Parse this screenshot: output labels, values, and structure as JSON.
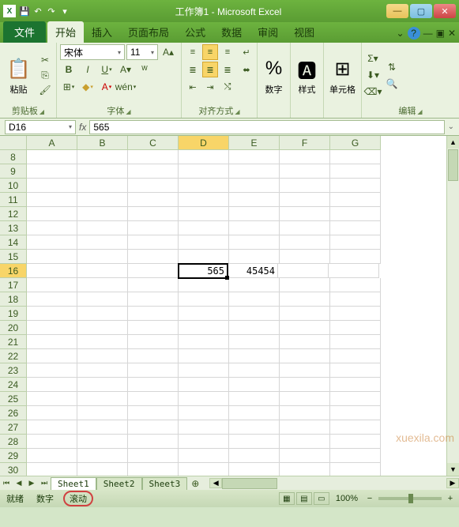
{
  "titlebar": {
    "app_icon": "X",
    "title": "工作簿1 - Microsoft Excel"
  },
  "tabs": {
    "file": "文件",
    "items": [
      "开始",
      "插入",
      "页面布局",
      "公式",
      "数据",
      "审阅",
      "视图"
    ],
    "active_index": 0
  },
  "ribbon": {
    "clipboard": {
      "label": "剪贴板",
      "paste": "粘贴"
    },
    "font": {
      "label": "字体",
      "name": "宋体",
      "size": "11"
    },
    "alignment": {
      "label": "对齐方式"
    },
    "number": {
      "label": "数字",
      "percent": "%"
    },
    "styles": {
      "label": "样式"
    },
    "cells": {
      "label": "单元格"
    },
    "editing": {
      "label": "编辑"
    }
  },
  "formula_bar": {
    "name_box": "D16",
    "fx": "fx",
    "formula": "565"
  },
  "grid": {
    "columns": [
      "A",
      "B",
      "C",
      "D",
      "E",
      "F",
      "G"
    ],
    "active_col_index": 3,
    "row_start": 8,
    "row_end": 30,
    "active_row": 16,
    "cells": {
      "D16": "565",
      "E16": "45454"
    }
  },
  "sheets": {
    "tabs": [
      "Sheet1",
      "Sheet2",
      "Sheet3"
    ],
    "active_index": 0
  },
  "statusbar": {
    "ready": "就绪",
    "num": "数字",
    "scroll": "滚动",
    "zoom": "100%"
  },
  "watermark": "xuexila.com"
}
